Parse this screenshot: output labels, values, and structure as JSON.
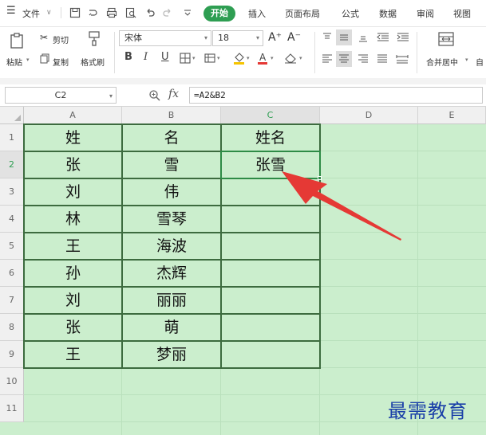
{
  "menubar": {
    "hamburger_icon": "menu-icon",
    "file_label": "文件",
    "file_chevron": "∨",
    "quick_icons": [
      "save-icon",
      "undo-history-icon",
      "print-icon",
      "print-preview-icon",
      "undo-icon",
      "redo-icon",
      "quick-access-dropdown-icon"
    ],
    "tabs": [
      {
        "label": "开始",
        "active": true
      },
      {
        "label": "插入"
      },
      {
        "label": "页面布局"
      },
      {
        "label": "公式"
      },
      {
        "label": "数据"
      },
      {
        "label": "审阅"
      },
      {
        "label": "视图"
      }
    ]
  },
  "ribbon": {
    "paste_label": "粘贴",
    "cut_label": "剪切",
    "copy_label": "复制",
    "format_painter_label": "格式刷",
    "font_name": "宋体",
    "font_size": "18",
    "grow_font_label": "A⁺",
    "shrink_font_label": "A⁻",
    "bold_label": "B",
    "italic_label": "I",
    "underline_label": "U",
    "merge_center_label": "合并居中",
    "more_label": "自",
    "accent_color": "#2e9e52",
    "font_color_swatch": "#e53935",
    "fill_color_swatch": "#f5c400"
  },
  "formula_bar": {
    "name_box": "C2",
    "zoom_icon": "find-icon",
    "fx_label": "fx",
    "formula": "=A2&B2"
  },
  "sheet": {
    "columns": [
      "A",
      "B",
      "C",
      "D",
      "E"
    ],
    "rows": [
      "1",
      "2",
      "3",
      "4",
      "5",
      "6",
      "7",
      "8",
      "9",
      "10",
      "11"
    ],
    "selected_cell": "C2",
    "selected_column": "C",
    "selected_row": "2",
    "cells": [
      [
        "姓",
        "名",
        "姓名"
      ],
      [
        "张",
        "雪",
        "张雪"
      ],
      [
        "刘",
        "伟",
        ""
      ],
      [
        "林",
        "雪琴",
        ""
      ],
      [
        "王",
        "海波",
        ""
      ],
      [
        "孙",
        "杰辉",
        ""
      ],
      [
        "刘",
        "丽丽",
        ""
      ],
      [
        "张",
        "萌",
        ""
      ],
      [
        "王",
        "梦丽",
        ""
      ]
    ],
    "background_color": "#cbeecd",
    "annotation_arrow_color": "#e53935"
  },
  "watermark": "最需教育"
}
